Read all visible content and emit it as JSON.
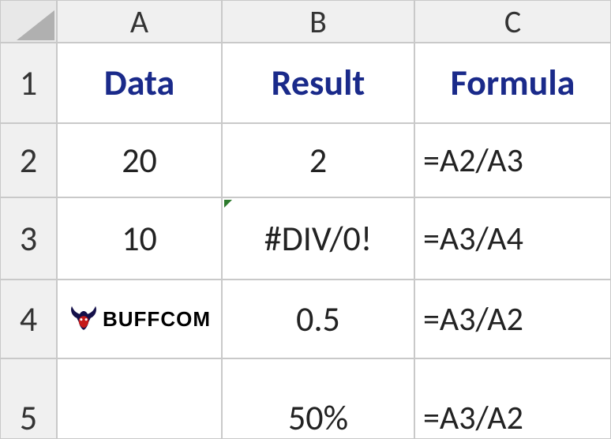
{
  "columns": {
    "A": "A",
    "B": "B",
    "C": "C"
  },
  "rows": {
    "r1": "1",
    "r2": "2",
    "r3": "3",
    "r4": "4",
    "r5": "5"
  },
  "headers": {
    "A": "Data",
    "B": "Result",
    "C": "Formula"
  },
  "grid": {
    "A2": "20",
    "B2": "2",
    "C2": "=A2/A3",
    "A3": "10",
    "B3": "#DIV/0!",
    "C3": "=A3/A4",
    "A4_logo_text": "BUFFCOM",
    "B4": "0.5",
    "C4": "=A3/A2",
    "B5": "50%",
    "C5": "=A3/A2"
  },
  "chart_data": {
    "type": "table",
    "title": "",
    "columns": [
      "Data",
      "Result",
      "Formula"
    ],
    "rows": [
      {
        "Data": 20,
        "Result": 2,
        "Formula": "=A2/A3"
      },
      {
        "Data": 10,
        "Result": "#DIV/0!",
        "Formula": "=A3/A4"
      },
      {
        "Data": null,
        "Result": 0.5,
        "Formula": "=A3/A2"
      },
      {
        "Data": null,
        "Result": "50%",
        "Formula": "=A3/A2"
      }
    ]
  }
}
